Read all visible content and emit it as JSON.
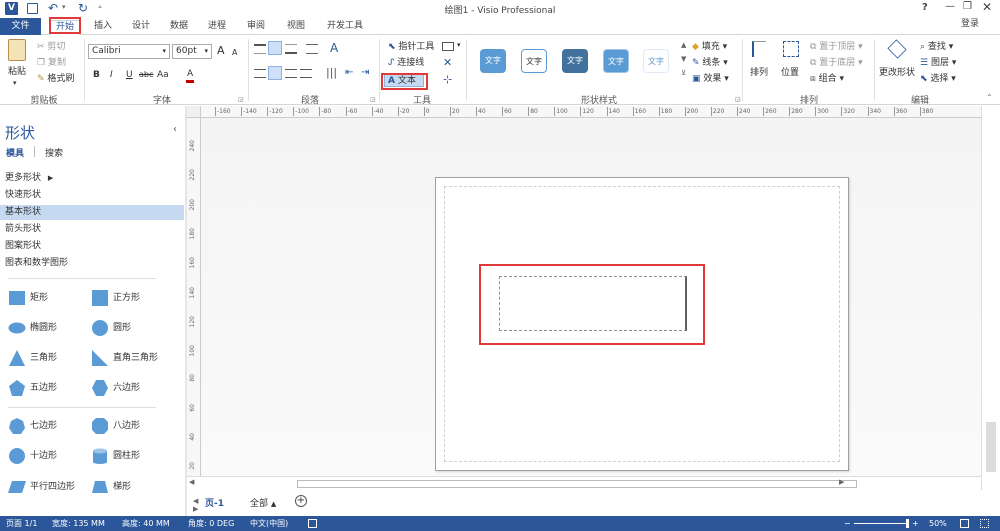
{
  "app": {
    "title": "绘图1 - Visio Professional",
    "app_icon": "V",
    "help": "?",
    "signin": "登录"
  },
  "ribbon_tabs": [
    "文件",
    "开始",
    "插入",
    "设计",
    "数据",
    "进程",
    "审阅",
    "视图",
    "开发工具"
  ],
  "clipboard": {
    "paste": "粘贴",
    "cut": "剪切",
    "copy": "复制",
    "format_painter": "格式刷",
    "group": "剪贴板"
  },
  "font": {
    "name": "Calibri",
    "size": "60pt",
    "grow": "A",
    "shrink": "A",
    "bold": "B",
    "italic": "I",
    "underline": "U",
    "strike": "abc",
    "case": "Aa",
    "color": "A",
    "group": "字体"
  },
  "paragraph": {
    "group": "段落"
  },
  "tools": {
    "pointer": "指针工具",
    "connector": "连接线",
    "text": "文本",
    "group": "工具"
  },
  "shape_styles": {
    "items": [
      "文字",
      "文字",
      "文字",
      "文字",
      "文字"
    ],
    "fill": "填充",
    "line": "线条",
    "effects": "效果",
    "group": "形状样式"
  },
  "arrange": {
    "align": "排列",
    "position": "位置",
    "bring_front": "置于顶层",
    "send_back": "置于底层",
    "group_cmd": "组合",
    "group": "排列"
  },
  "editing": {
    "change_shape": "更改形状",
    "find": "查找",
    "layers": "图层",
    "select": "选择",
    "group": "编辑"
  },
  "sidebar": {
    "title": "形状",
    "tab_stencils": "模具",
    "tab_search": "搜索",
    "nav": [
      "更多形状",
      "快速形状",
      "基本形状",
      "箭头形状",
      "图案形状",
      "图表和数学图形"
    ],
    "shapes": [
      [
        "矩形",
        "正方形"
      ],
      [
        "椭圆形",
        "圆形"
      ],
      [
        "三角形",
        "直角三角形"
      ],
      [
        "五边形",
        "六边形"
      ],
      [
        "七边形",
        "八边形"
      ],
      [
        "十边形",
        "圆柱形"
      ],
      [
        "平行四边形",
        "梯形"
      ]
    ]
  },
  "ruler": {
    "h_ticks": [
      "-160",
      "-140",
      "-120",
      "-100",
      "-80",
      "-60",
      "-40",
      "-20",
      "0",
      "20",
      "40",
      "60",
      "80",
      "100",
      "120",
      "140",
      "160",
      "180",
      "200",
      "220",
      "240",
      "260",
      "280",
      "300",
      "320",
      "340",
      "360",
      "380"
    ],
    "v_ticks": [
      "240",
      "220",
      "200",
      "180",
      "160",
      "140",
      "120",
      "100",
      "80",
      "60",
      "40",
      "20"
    ]
  },
  "pages": {
    "current": "页-1",
    "all": "全部",
    "add": "+"
  },
  "status": {
    "page": "页面 1/1",
    "width": "宽度: 135 MM",
    "height": "高度: 40 MM",
    "angle": "角度: 0 DEG",
    "language": "中文(中国)",
    "zoom": "50%"
  },
  "colors": {
    "accent": "#2b579a",
    "highlight": "#e03a3a",
    "shape_fill": "#5b9bd5"
  }
}
